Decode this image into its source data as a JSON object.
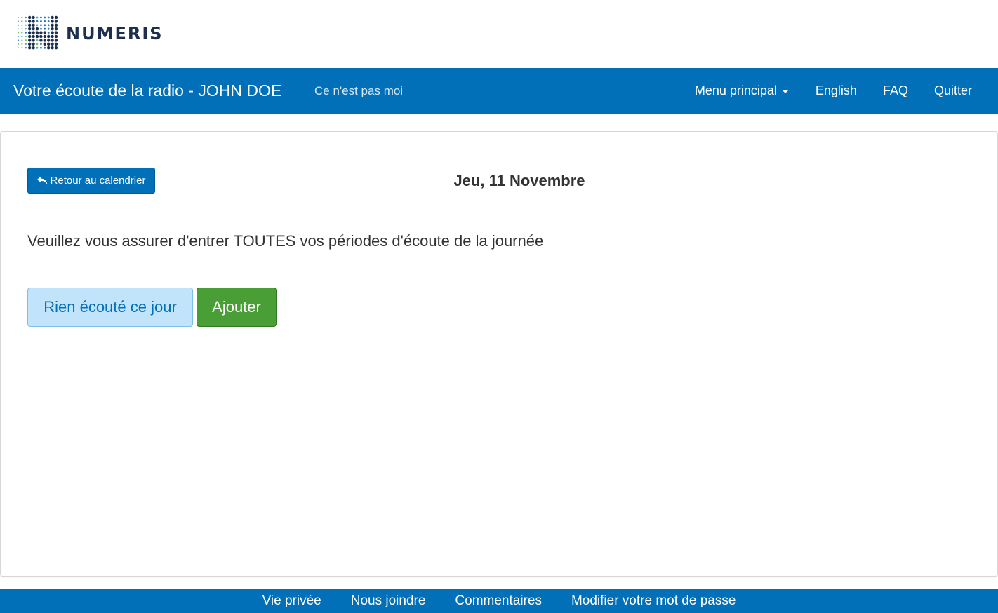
{
  "logo": {
    "text": "NUMERIS",
    "icon": "numeris-dotted-n-logo"
  },
  "navbar": {
    "title": "Votre écoute de la radio - JOHN DOE",
    "not_me": "Ce n'est pas moi",
    "menu_main": "Menu principal",
    "english": "English",
    "faq": "FAQ",
    "quit": "Quitter"
  },
  "content": {
    "back_button": "Retour au calendrier",
    "back_icon": "reply-arrow-icon",
    "date": "Jeu, 11 Novembre",
    "instruction": "Veuillez vous assurer d'entrer TOUTES vos périodes d'écoute de la journée",
    "nothing_button": "Rien écouté ce jour",
    "add_button": "Ajouter"
  },
  "footer": {
    "links": [
      "Vie privée",
      "Nous joindre",
      "Commentaires",
      "Modifier votre mot de passe"
    ]
  },
  "colors": {
    "primary": "#0170b8",
    "success": "#4a9e36",
    "light_info": "#c1e4fb",
    "logo_text": "#1d2f4f"
  }
}
